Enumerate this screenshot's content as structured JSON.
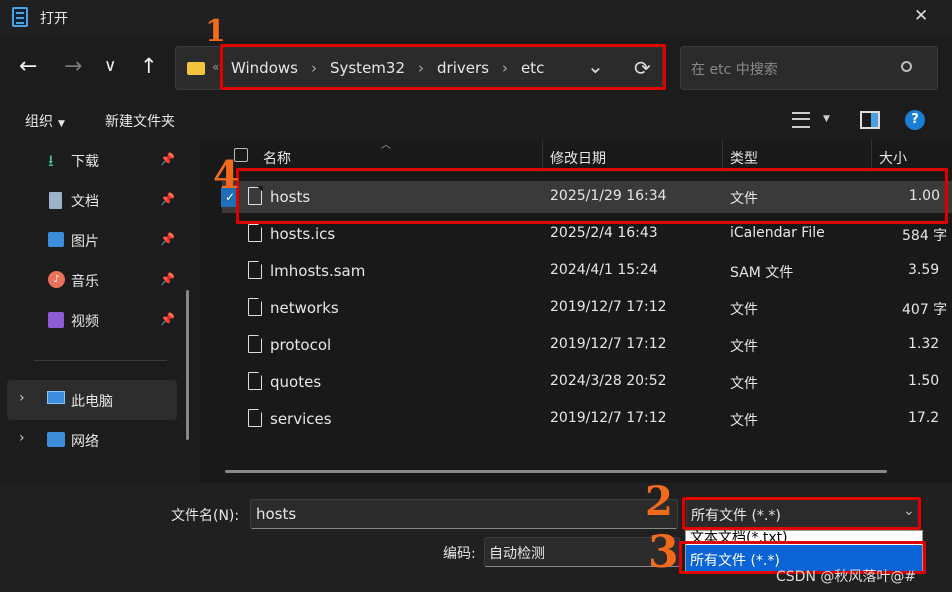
{
  "window": {
    "title": "打开",
    "close": "✕"
  },
  "nav": {
    "back": "←",
    "forward": "→",
    "recent": "∨",
    "up": "↑",
    "path": [
      "Windows",
      "System32",
      "drivers",
      "etc"
    ],
    "sep": "›",
    "overflow": "«",
    "refresh": "⟳",
    "dropdown": "⌄",
    "search_placeholder": "在 etc 中搜索"
  },
  "toolbar": {
    "organize": "组织",
    "new_folder": "新建文件夹",
    "help": "?"
  },
  "sidebar": {
    "quick": [
      {
        "label": "下载",
        "icon": "download-icon"
      },
      {
        "label": "文档",
        "icon": "document-icon"
      },
      {
        "label": "图片",
        "icon": "picture-icon"
      },
      {
        "label": "音乐",
        "icon": "music-icon"
      },
      {
        "label": "视频",
        "icon": "video-icon"
      }
    ],
    "this_pc": "此电脑",
    "network": "网络"
  },
  "columns": {
    "name": "名称",
    "date": "修改日期",
    "type": "类型",
    "size": "大小"
  },
  "files": [
    {
      "name": "hosts",
      "date": "2025/1/29 16:34",
      "type": "文件",
      "size": "1.00"
    },
    {
      "name": "hosts.ics",
      "date": "2025/2/4 16:43",
      "type": "iCalendar File",
      "size": "584 字"
    },
    {
      "name": "lmhosts.sam",
      "date": "2024/4/1 15:24",
      "type": "SAM 文件",
      "size": "3.59"
    },
    {
      "name": "networks",
      "date": "2019/12/7 17:12",
      "type": "文件",
      "size": "407 字"
    },
    {
      "name": "protocol",
      "date": "2019/12/7 17:12",
      "type": "文件",
      "size": "1.32"
    },
    {
      "name": "quotes",
      "date": "2024/3/28 20:52",
      "type": "文件",
      "size": "1.50"
    },
    {
      "name": "services",
      "date": "2019/12/7 17:12",
      "type": "文件",
      "size": "17.2"
    }
  ],
  "bottom": {
    "filename_label": "文件名(N):",
    "filename_value": "hosts",
    "filter_value": "所有文件  (*.*)",
    "encoding_label": "编码:",
    "encoding_value": "自动检测",
    "dropdown_options": [
      "文本文档(*.txt)",
      "所有文件  (*.*)"
    ]
  },
  "annotations": {
    "n1": "1",
    "n2": "2",
    "n3": "3",
    "n4": "4"
  },
  "watermark": "CSDN @秋风落叶@#",
  "colors": {
    "red_box": "#e00000",
    "annotation": "#f26b1d",
    "selected_option": "#0a64d6"
  }
}
